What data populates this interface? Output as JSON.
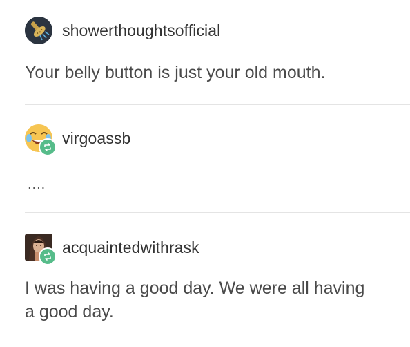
{
  "posts": [
    {
      "username": "showerthoughtsofficial",
      "text": "Your belly button is just your old mouth.",
      "avatar_icon": "showerhead-avatar-icon"
    },
    {
      "username": "virgoassb",
      "text": "....",
      "avatar_icon": "crying-laughing-emoji-avatar-icon",
      "reblog_icon": "reblog-icon"
    },
    {
      "username": "acquaintedwithrask",
      "text": "I was having a good day. We were all having a good day.",
      "avatar_icon": "painting-portrait-avatar-icon",
      "reblog_icon": "reblog-icon"
    }
  ],
  "colors": {
    "reblog_badge": "#56bc8a",
    "divider": "#e4e4e4",
    "text": "#4a4a4a"
  }
}
